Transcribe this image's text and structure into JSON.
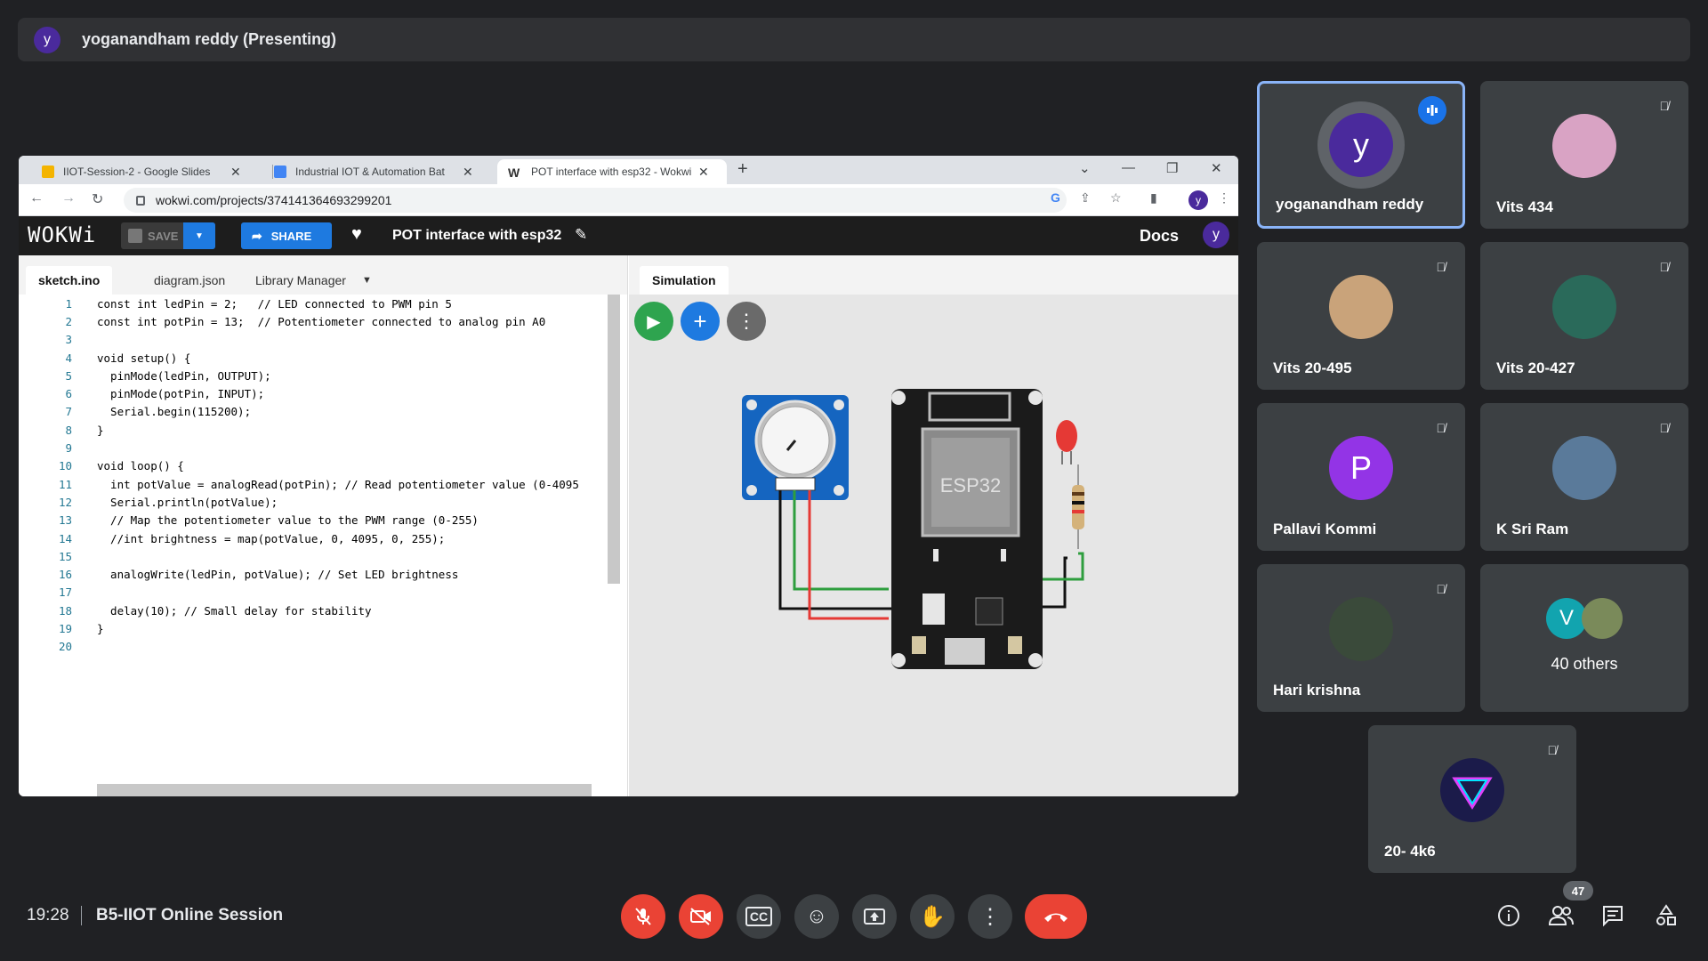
{
  "presenter": {
    "avatar_letter": "y",
    "label": "yoganandham reddy (Presenting)"
  },
  "browser": {
    "tabs": [
      {
        "title": "IIOT-Session-2 - Google Slides",
        "favicon_color": "#f4b400"
      },
      {
        "title": "Industrial IOT & Automation Bat",
        "favicon_color": "#4285f4"
      },
      {
        "title": "POT interface with esp32 - Wokwi",
        "favicon_color": "#333333"
      }
    ],
    "url": "wokwi.com/projects/374141364693299201",
    "profile_letter": "y"
  },
  "wokwi": {
    "logo": "WOKWi",
    "save_label": "SAVE",
    "share_label": "SHARE",
    "project_title": "POT interface with esp32",
    "docs_label": "Docs",
    "profile_letter": "y",
    "editor_tabs": [
      "sketch.ino",
      "diagram.json",
      "Library Manager"
    ],
    "simulation_tab": "Simulation",
    "board_label": "ESP32",
    "code_lines": [
      {
        "n": "1",
        "t": "const int ledPin = 2;   // LED connected to PWM pin 5"
      },
      {
        "n": "2",
        "t": "const int potPin = 13;  // Potentiometer connected to analog pin A0"
      },
      {
        "n": "3",
        "t": ""
      },
      {
        "n": "4",
        "t": "void setup() {"
      },
      {
        "n": "5",
        "t": "  pinMode(ledPin, OUTPUT);"
      },
      {
        "n": "6",
        "t": "  pinMode(potPin, INPUT);"
      },
      {
        "n": "7",
        "t": "  Serial.begin(115200);"
      },
      {
        "n": "8",
        "t": "}"
      },
      {
        "n": "9",
        "t": ""
      },
      {
        "n": "10",
        "t": "void loop() {"
      },
      {
        "n": "11",
        "t": "  int potValue = analogRead(potPin); // Read potentiometer value (0-4095"
      },
      {
        "n": "12",
        "t": "  Serial.println(potValue);"
      },
      {
        "n": "13",
        "t": "  // Map the potentiometer value to the PWM range (0-255)"
      },
      {
        "n": "14",
        "t": "  //int brightness = map(potValue, 0, 4095, 0, 255);"
      },
      {
        "n": "15",
        "t": ""
      },
      {
        "n": "16",
        "t": "  analogWrite(ledPin, potValue); // Set LED brightness"
      },
      {
        "n": "17",
        "t": ""
      },
      {
        "n": "18",
        "t": "  delay(10); // Small delay for stability"
      },
      {
        "n": "19",
        "t": "}"
      },
      {
        "n": "20",
        "t": ""
      }
    ]
  },
  "participants": [
    {
      "name": "yoganandham reddy",
      "avatar": "y",
      "avatar_color": "#4a2a9c",
      "speaking": true
    },
    {
      "name": "Vits 434",
      "avatar": "",
      "avatar_color": "#d9a3c4",
      "muted": true
    },
    {
      "name": "Vits 20-495",
      "avatar": "",
      "avatar_color": "#c9a37a",
      "muted": true
    },
    {
      "name": "Vits 20-427",
      "avatar": "",
      "avatar_color": "#2a6a5a",
      "muted": true
    },
    {
      "name": "Pallavi Kommi",
      "avatar": "P",
      "avatar_color": "#9334e6",
      "muted": true
    },
    {
      "name": "K Sri Ram",
      "avatar": "",
      "avatar_color": "#5a7a9a",
      "muted": true
    },
    {
      "name": "Hari krishna",
      "avatar": "",
      "avatar_color": "#3a4a3a",
      "muted": true
    },
    {
      "name": "40 others",
      "avatar": "V",
      "avatar_color": "#12a4af"
    },
    {
      "name": "20- 4k6",
      "avatar": "",
      "avatar_color": "#1b1b4a",
      "muted": true
    }
  ],
  "footer": {
    "time": "19:28",
    "meeting_name": "B5-IIOT Online Session",
    "participant_count": "47"
  }
}
